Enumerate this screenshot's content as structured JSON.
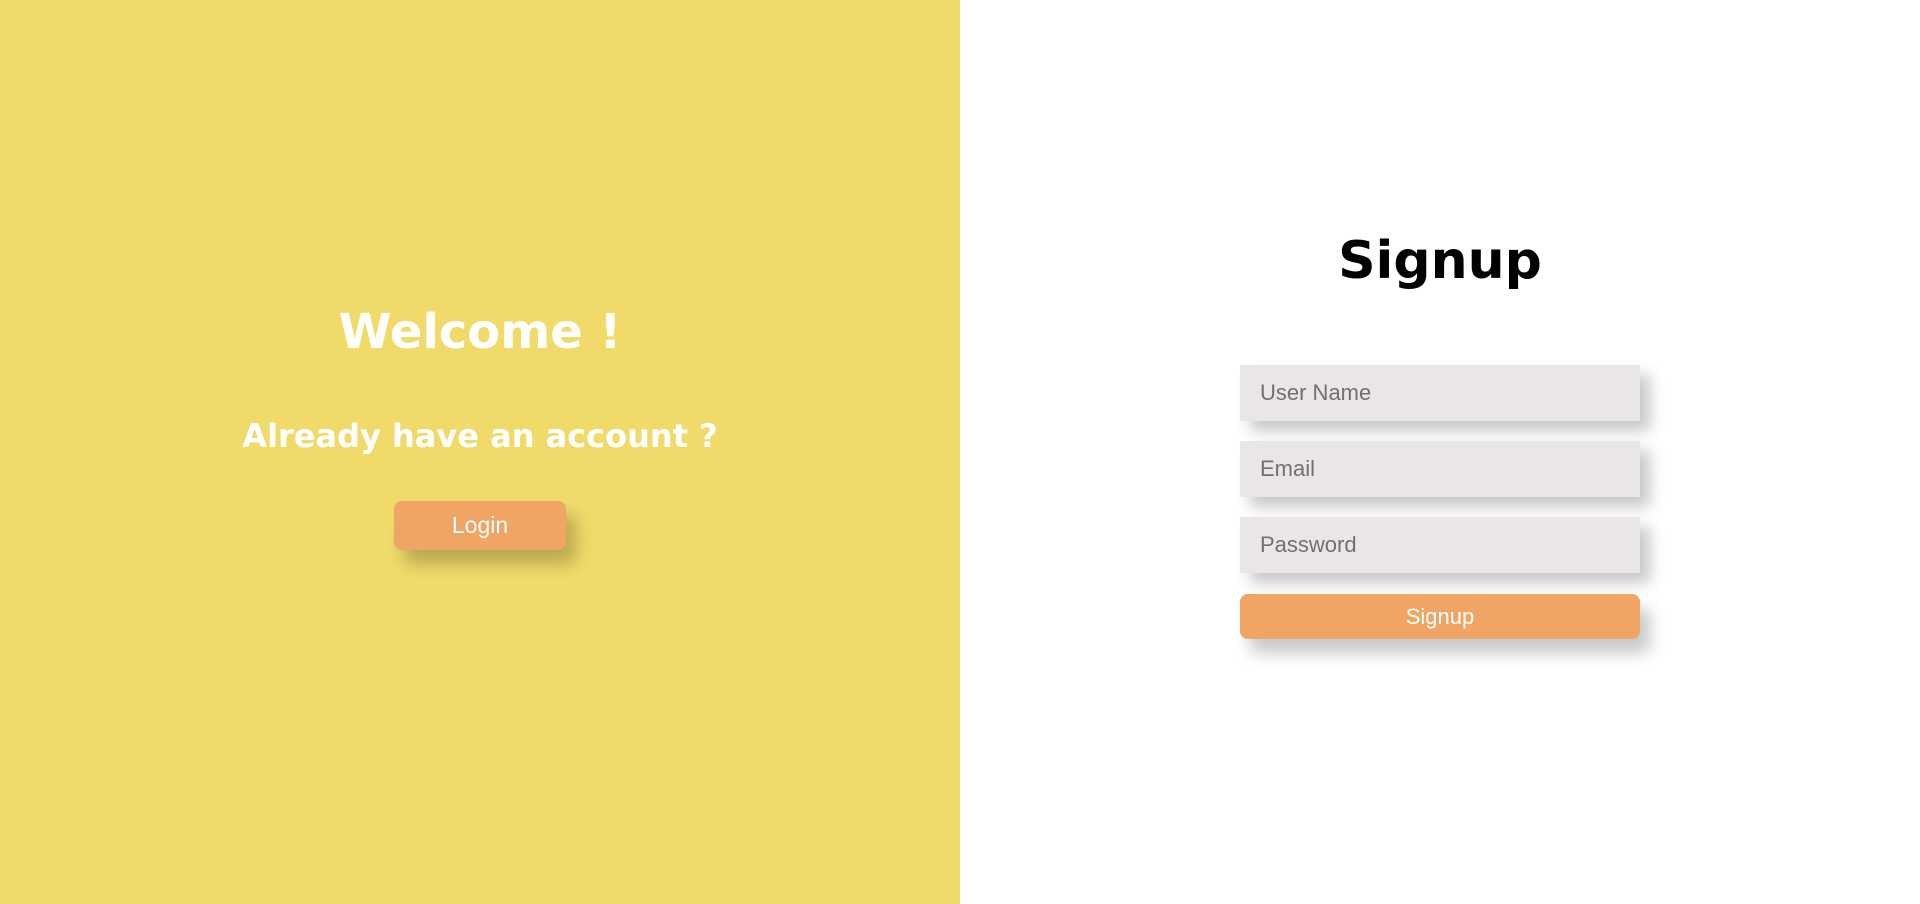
{
  "colors": {
    "left_background": "#EFDA6A",
    "right_background": "#FFFFFF",
    "button": "#F0A565",
    "input_background": "#EAE6E6"
  },
  "welcome": {
    "title": "Welcome !",
    "subtitle": "Already have an account ?",
    "login_label": "Login"
  },
  "signup": {
    "title": "Signup",
    "username_placeholder": "User Name",
    "email_placeholder": "Email",
    "password_placeholder": "Password",
    "button_label": "Signup"
  }
}
